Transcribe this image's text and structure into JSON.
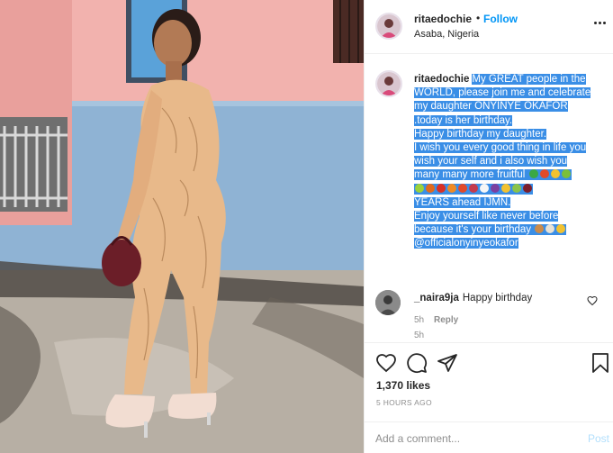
{
  "post": {
    "username": "ritaedochie",
    "separator": "•",
    "follow_label": "Follow",
    "location": "Asaba, Nigeria",
    "more_icon": "more-horizontal-icon"
  },
  "caption": {
    "username": "ritaedochie",
    "lines": [
      "My GREAT people in the",
      "WORLD, please join me and celebrate",
      "my daughter ONYINYE OKAFOR",
      ".today is her birthday.",
      "Happy birthday my daughter.",
      "I wish you every good thing in life you",
      "wish your self and i also wish you",
      "many many more fruitful",
      "",
      "YEARS ahead IJMN.",
      "Enjoy yourself like never before",
      "because it's your birthday",
      "@officialonyinyeokafor"
    ],
    "emoji_colors_line8": [
      "#3aa845",
      "#e24a2a",
      "#f2c230",
      "#7bbf3a"
    ],
    "emoji_colors_line9": [
      "#9ad13b",
      "#e06a1e",
      "#d93025",
      "#f08a24",
      "#e24a2a",
      "#c53a4c",
      "#f6f6f6",
      "#7b3fa0",
      "#f2c230",
      "#8bc34a",
      "#7b1e2b"
    ],
    "emoji_colors_line12": [
      "#c98a4b",
      "#e8e2d6",
      "#f2c230"
    ],
    "time": "5h",
    "highlight_color": "#3a8ee6"
  },
  "comment": {
    "username": "_naira9ja",
    "text": "Happy birthday",
    "time": "5h",
    "reply_label": "Reply",
    "like_icon": "heart-outline-icon"
  },
  "actions": {
    "like_icon": "heart-outline-icon",
    "comment_icon": "comment-bubble-icon",
    "share_icon": "paper-plane-icon",
    "save_icon": "bookmark-icon",
    "likes": "1,370 likes",
    "posted_ago": "5 HOURS AGO"
  },
  "add_comment": {
    "placeholder": "Add a comment...",
    "post_label": "Post"
  },
  "colors": {
    "link_blue": "#0095f6",
    "muted": "#8e8e8e",
    "post_disabled": "#b2dffc"
  }
}
